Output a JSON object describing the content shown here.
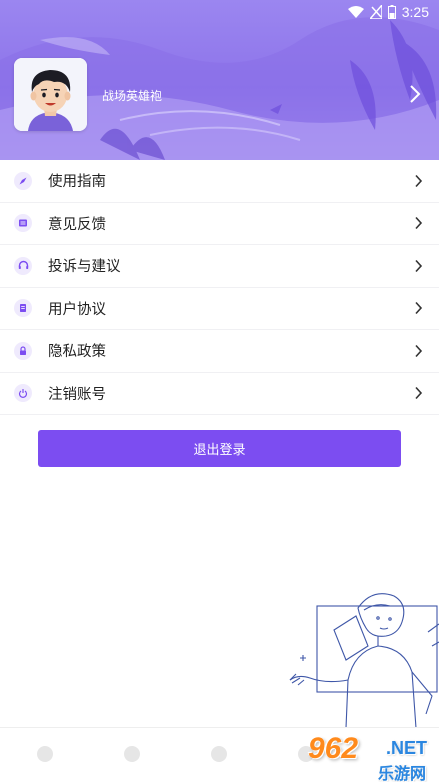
{
  "status_bar": {
    "time": "3:25"
  },
  "profile": {
    "username": "战场英雄袍"
  },
  "menu": {
    "items": [
      {
        "label": "使用指南",
        "icon": "compass-icon"
      },
      {
        "label": "意见反馈",
        "icon": "feedback-icon"
      },
      {
        "label": "投诉与建议",
        "icon": "headset-icon"
      },
      {
        "label": "用户协议",
        "icon": "document-icon"
      },
      {
        "label": "隐私政策",
        "icon": "lock-icon"
      },
      {
        "label": "注销账号",
        "icon": "power-icon"
      }
    ]
  },
  "logout_label": "退出登录",
  "watermark": {
    "number": "962",
    "suffix": ".NET",
    "site": "乐游网"
  },
  "colors": {
    "accent": "#7c4df1",
    "header": "#8d74ea",
    "icon_bg": "#efeafd"
  }
}
